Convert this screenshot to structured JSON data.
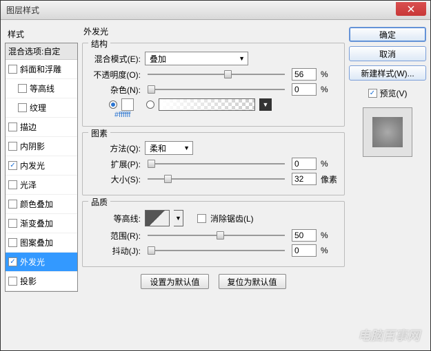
{
  "window": {
    "title": "图层样式"
  },
  "left": {
    "heading": "样式",
    "blend_options": "混合选项:自定",
    "styles": [
      {
        "label": "斜面和浮雕",
        "checked": false,
        "indent": false,
        "selected": false
      },
      {
        "label": "等高线",
        "checked": false,
        "indent": true,
        "selected": false
      },
      {
        "label": "纹理",
        "checked": false,
        "indent": true,
        "selected": false
      },
      {
        "label": "描边",
        "checked": false,
        "indent": false,
        "selected": false
      },
      {
        "label": "内阴影",
        "checked": false,
        "indent": false,
        "selected": false
      },
      {
        "label": "内发光",
        "checked": true,
        "indent": false,
        "selected": false
      },
      {
        "label": "光泽",
        "checked": false,
        "indent": false,
        "selected": false
      },
      {
        "label": "颜色叠加",
        "checked": false,
        "indent": false,
        "selected": false
      },
      {
        "label": "渐变叠加",
        "checked": false,
        "indent": false,
        "selected": false
      },
      {
        "label": "图案叠加",
        "checked": false,
        "indent": false,
        "selected": false
      },
      {
        "label": "外发光",
        "checked": true,
        "indent": false,
        "selected": true
      },
      {
        "label": "投影",
        "checked": false,
        "indent": false,
        "selected": false
      }
    ]
  },
  "mid": {
    "panel_title": "外发光",
    "structure": {
      "legend": "结构",
      "blend_mode_label": "混合模式(E):",
      "blend_mode_value": "叠加",
      "opacity_label": "不透明度(O):",
      "opacity_value": "56",
      "opacity_unit": "%",
      "noise_label": "杂色(N):",
      "noise_value": "0",
      "noise_unit": "%",
      "color_hex": "#ffffff"
    },
    "elements": {
      "legend": "图素",
      "technique_label": "方法(Q):",
      "technique_value": "柔和",
      "spread_label": "扩展(P):",
      "spread_value": "0",
      "spread_unit": "%",
      "size_label": "大小(S):",
      "size_value": "32",
      "size_unit": "像素"
    },
    "quality": {
      "legend": "品质",
      "contour_label": "等高线:",
      "antialias_label": "消除锯齿(L)",
      "range_label": "范围(R):",
      "range_value": "50",
      "range_unit": "%",
      "jitter_label": "抖动(J):",
      "jitter_value": "0",
      "jitter_unit": "%"
    },
    "btn_default": "设置为默认值",
    "btn_reset": "复位为默认值"
  },
  "right": {
    "ok": "确定",
    "cancel": "取消",
    "new_style": "新建样式(W)...",
    "preview_label": "预览(V)"
  },
  "watermark": "电脑百事网"
}
